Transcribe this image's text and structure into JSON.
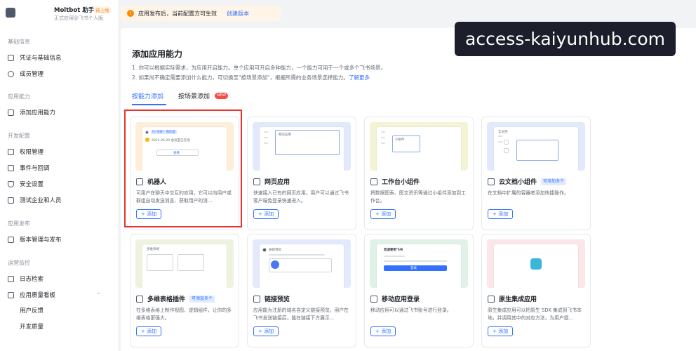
{
  "app": {
    "name": "Moltbot 助手",
    "badge": "待上线",
    "subtitle": "正式应用@飞书个人版"
  },
  "banner": {
    "text": "应用发布后，当前配置方可生效",
    "link": "创建版本"
  },
  "overlay": {
    "text": "access-kaiyunhub.com"
  },
  "sidebar": {
    "sections": [
      {
        "label": "基础信息",
        "items": [
          {
            "label": "凭证与基础信息",
            "icon": "key-icon"
          },
          {
            "label": "成员管理",
            "icon": "user-icon"
          }
        ]
      },
      {
        "label": "应用能力",
        "items": [
          {
            "label": "添加应用能力",
            "icon": "grid-icon"
          }
        ]
      },
      {
        "label": "开发配置",
        "items": [
          {
            "label": "权限管理",
            "icon": "lock-icon"
          },
          {
            "label": "事件与回调",
            "icon": "event-icon"
          },
          {
            "label": "安全设置",
            "icon": "shield-icon"
          },
          {
            "label": "测试企业和人员",
            "icon": "test-icon"
          }
        ]
      },
      {
        "label": "应用发布",
        "items": [
          {
            "label": "版本管理与发布",
            "icon": "upload-icon"
          }
        ]
      },
      {
        "label": "运营监控",
        "items": [
          {
            "label": "日志检索",
            "icon": "log-icon"
          },
          {
            "label": "应用质量看板",
            "icon": "chart-icon"
          },
          {
            "label": "用户反馈"
          },
          {
            "label": "开发质量"
          }
        ]
      }
    ]
  },
  "main": {
    "title": "添加应用能力",
    "desc1": "1. 你可以根据实际需求，为应用开启能力。单个应用可开启多种能力，一个能力可用于一个或多个飞书场景。",
    "desc2": "2. 如果尚不确定需要添加什么能力，可切换至\"按场景添加\"，根据所需的业务场景选择能力。",
    "desc2_link": "了解更多",
    "tabs": [
      {
        "label": "按能力添加",
        "active": true
      },
      {
        "label": "按场景添加",
        "badge": "NEW"
      }
    ]
  },
  "cards": [
    {
      "title": "机器人",
      "icon": "robot-icon",
      "desc": "可用户在聊天中交互的应用，它可以向用户或群组自动发送消息、获取用户的消...",
      "add": "+ 添加",
      "bg": "#fdeeda",
      "preview": {
        "chip": "Hi 你好！我的是",
        "date": "2022-05-20 会议室已在线",
        "button": "查看"
      }
    },
    {
      "title": "网页应用",
      "icon": "web-icon",
      "desc": "快速接入已有的网页应用。用户可以通过飞书客户端免登录快速进入。",
      "add": "+ 添加",
      "bg": "#e2e9fb",
      "preview": {
        "label": "网页应用"
      }
    },
    {
      "title": "工作台小组件",
      "icon": "widget-icon",
      "desc": "将数据图表、图文资讯等通过小组件添加到工作台。",
      "add": "+ 添加",
      "bg": "#f4f3d6",
      "preview": {
        "label": "小组件"
      }
    },
    {
      "title": "云文档小组件",
      "icon": "doc-icon",
      "tag": "可添加多个",
      "desc": "在文档中扩展的容器者添加快捷操作。",
      "add": "+ 添加",
      "bg": "#e1e9fb",
      "preview": {
        "label": "云文档"
      }
    },
    {
      "title": "多维表格插件",
      "icon": "table-icon",
      "tag": "可添加多个",
      "desc": "在多维表格上制作视图、逻辑组件，让你的多维表格更强大。",
      "add": "+ 添加",
      "bg": "#eef3e0",
      "preview": {
        "label": "多维表格"
      }
    },
    {
      "title": "链接预览",
      "icon": "link-icon",
      "desc": "应用能为注册的域名自定义链接预览。用户在飞书发送链接后，能在链接下方展示...",
      "add": "+ 添加",
      "bg": "#e3eafc",
      "preview": {
        "label": "链接预览"
      }
    },
    {
      "title": "移动应用登录",
      "icon": "login-icon",
      "desc": "移动应用可以通过飞书账号进行登录。",
      "add": "+ 添加",
      "bg": "#e0f2e8",
      "preview": {
        "label": "欢迎使用飞书",
        "button": "登录"
      }
    },
    {
      "title": "原生集成应用",
      "icon": "native-icon",
      "desc": "原生集成应用可以把原生 SDK 集成到飞书本地，并调用其中的对应方法，为用户提...",
      "add": "+ 添加",
      "bg": "#fbe6ea",
      "preview": {}
    }
  ]
}
